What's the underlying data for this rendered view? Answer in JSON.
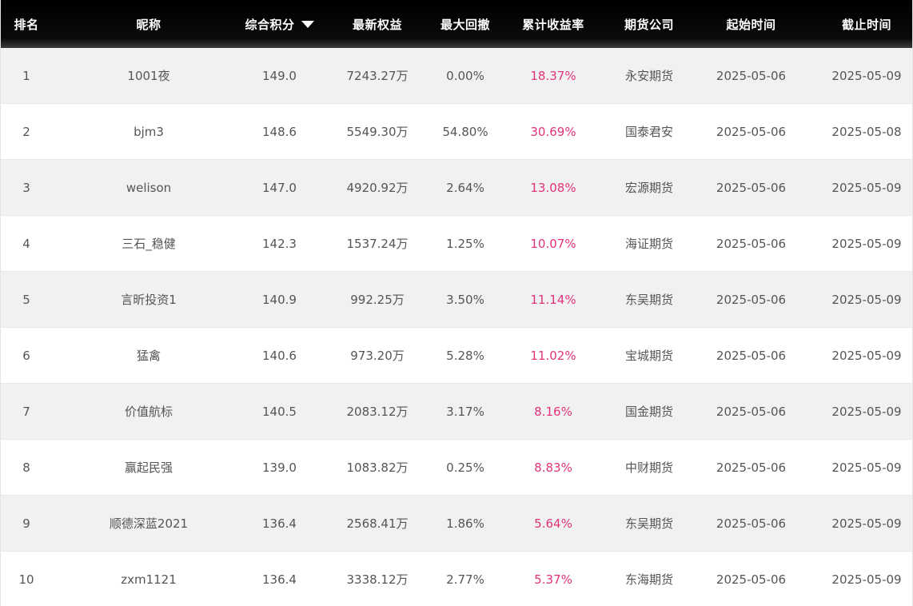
{
  "columns": {
    "rank": "排名",
    "nickname": "昵称",
    "score": "综合积分",
    "equity": "最新权益",
    "max_drawdown": "最大回撤",
    "cum_return": "累计收益率",
    "broker": "期货公司",
    "start_date": "起始时间",
    "end_date": "截止时间"
  },
  "sort_icon": "caret-down-icon",
  "colors": {
    "header_bg": "#000000",
    "return_text": "#e2337a",
    "row_alt": "#f1f1f1"
  },
  "rows": [
    {
      "rank": "1",
      "nickname": "1001夜",
      "score": "149.0",
      "equity": "7243.27万",
      "max_drawdown": "0.00%",
      "cum_return": "18.37%",
      "broker": "永安期货",
      "start_date": "2025-05-06",
      "end_date": "2025-05-09"
    },
    {
      "rank": "2",
      "nickname": "bjm3",
      "score": "148.6",
      "equity": "5549.30万",
      "max_drawdown": "54.80%",
      "cum_return": "30.69%",
      "broker": "国泰君安",
      "start_date": "2025-05-06",
      "end_date": "2025-05-08"
    },
    {
      "rank": "3",
      "nickname": "welison",
      "score": "147.0",
      "equity": "4920.92万",
      "max_drawdown": "2.64%",
      "cum_return": "13.08%",
      "broker": "宏源期货",
      "start_date": "2025-05-06",
      "end_date": "2025-05-09"
    },
    {
      "rank": "4",
      "nickname": "三石_稳健",
      "score": "142.3",
      "equity": "1537.24万",
      "max_drawdown": "1.25%",
      "cum_return": "10.07%",
      "broker": "海证期货",
      "start_date": "2025-05-06",
      "end_date": "2025-05-09"
    },
    {
      "rank": "5",
      "nickname": "言昕投资1",
      "score": "140.9",
      "equity": "992.25万",
      "max_drawdown": "3.50%",
      "cum_return": "11.14%",
      "broker": "东吴期货",
      "start_date": "2025-05-06",
      "end_date": "2025-05-09"
    },
    {
      "rank": "6",
      "nickname": "猛禽",
      "score": "140.6",
      "equity": "973.20万",
      "max_drawdown": "5.28%",
      "cum_return": "11.02%",
      "broker": "宝城期货",
      "start_date": "2025-05-06",
      "end_date": "2025-05-09"
    },
    {
      "rank": "7",
      "nickname": "价值航标",
      "score": "140.5",
      "equity": "2083.12万",
      "max_drawdown": "3.17%",
      "cum_return": "8.16%",
      "broker": "国金期货",
      "start_date": "2025-05-06",
      "end_date": "2025-05-09"
    },
    {
      "rank": "8",
      "nickname": "赢起民强",
      "score": "139.0",
      "equity": "1083.82万",
      "max_drawdown": "0.25%",
      "cum_return": "8.83%",
      "broker": "中财期货",
      "start_date": "2025-05-06",
      "end_date": "2025-05-09"
    },
    {
      "rank": "9",
      "nickname": "顺德深蓝2021",
      "score": "136.4",
      "equity": "2568.41万",
      "max_drawdown": "1.86%",
      "cum_return": "5.64%",
      "broker": "东吴期货",
      "start_date": "2025-05-06",
      "end_date": "2025-05-09"
    },
    {
      "rank": "10",
      "nickname": "zxm1121",
      "score": "136.4",
      "equity": "3338.12万",
      "max_drawdown": "2.77%",
      "cum_return": "5.37%",
      "broker": "东海期货",
      "start_date": "2025-05-06",
      "end_date": "2025-05-09"
    }
  ]
}
